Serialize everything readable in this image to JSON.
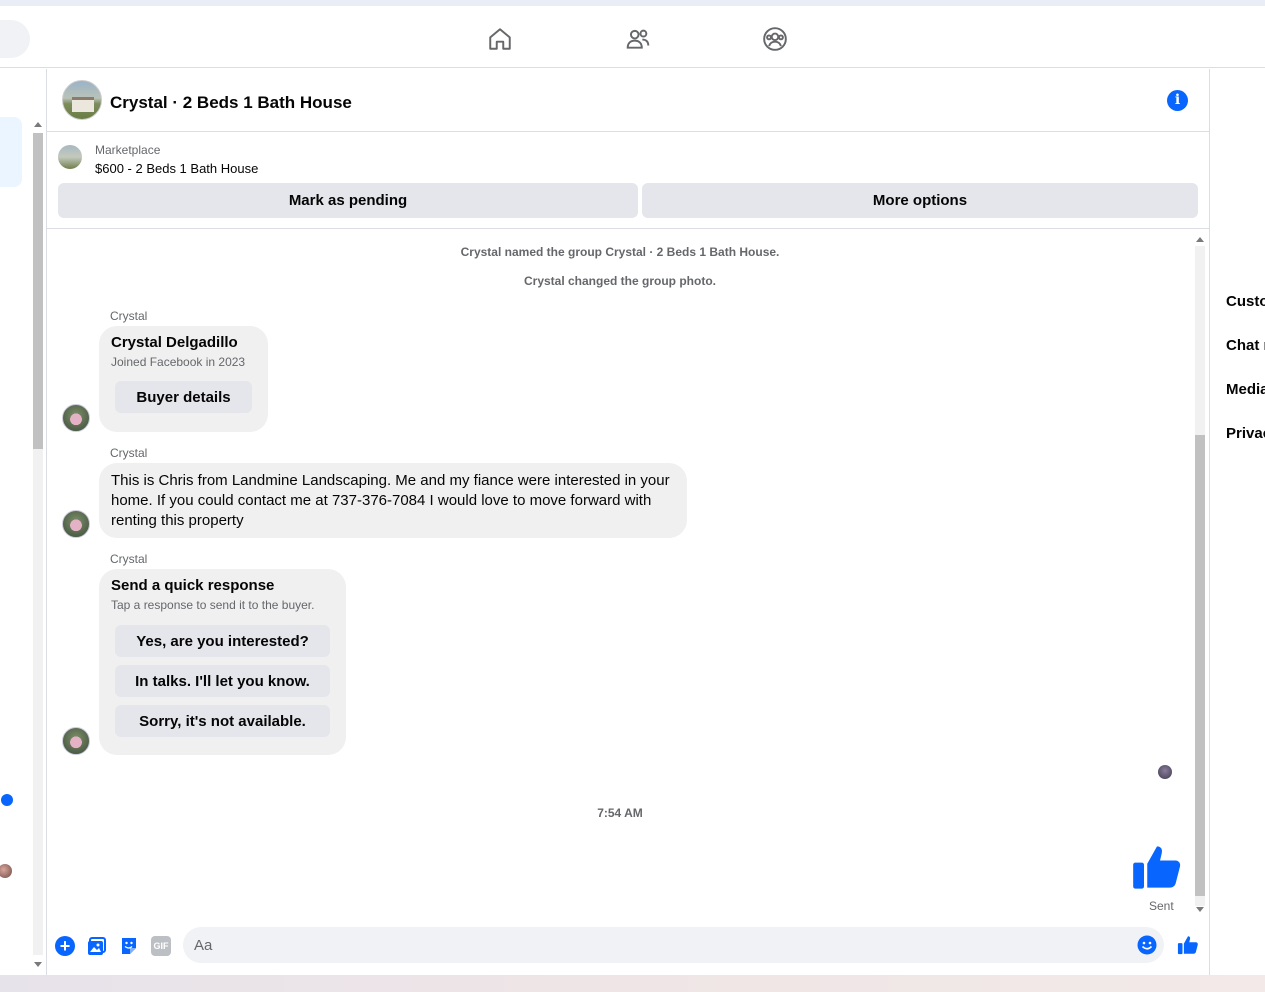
{
  "nav": {
    "icons": [
      "home-icon",
      "friends-icon",
      "groups-icon"
    ]
  },
  "chat": {
    "title": "Crystal · 2 Beds 1 Bath House",
    "info_icon": "i"
  },
  "marketplace": {
    "label": "Marketplace",
    "listing": "$600 - 2 Beds 1 Bath House",
    "pending_button": "Mark as pending",
    "more_button": "More options"
  },
  "messages": {
    "system_1": "Crystal named the group Crystal · 2 Beds 1 Bath House.",
    "system_2": "Crystal changed the group photo.",
    "card": {
      "sender": "Crystal",
      "name": "Crystal Delgadillo",
      "joined": "Joined Facebook in 2023",
      "button": "Buyer details"
    },
    "text_message": {
      "sender": "Crystal",
      "text": "This is Chris from Landmine Landscaping. Me and my fiance were interested in your home. If you could contact me at 737-376-7084 I would love to move forward with renting this property"
    },
    "quick_response": {
      "sender": "Crystal",
      "title": "Send a quick response",
      "subtitle": "Tap a response to send it to the buyer.",
      "options": [
        "Yes, are you interested?",
        "In talks. I'll let you know.",
        "Sorry, it's not available."
      ]
    },
    "timestamp": "7:54 AM",
    "sent_label": "Sent"
  },
  "composer": {
    "placeholder": "Aa",
    "gif_label": "GIF",
    "plus_label": "+"
  },
  "right_panel": {
    "items": [
      "Custo",
      "Chat r",
      "Media",
      "Privac"
    ]
  },
  "colors": {
    "accent": "#0866ff",
    "bubble": "#f0f0f0",
    "button": "#e4e6eb",
    "secondary_text": "#65676b"
  }
}
